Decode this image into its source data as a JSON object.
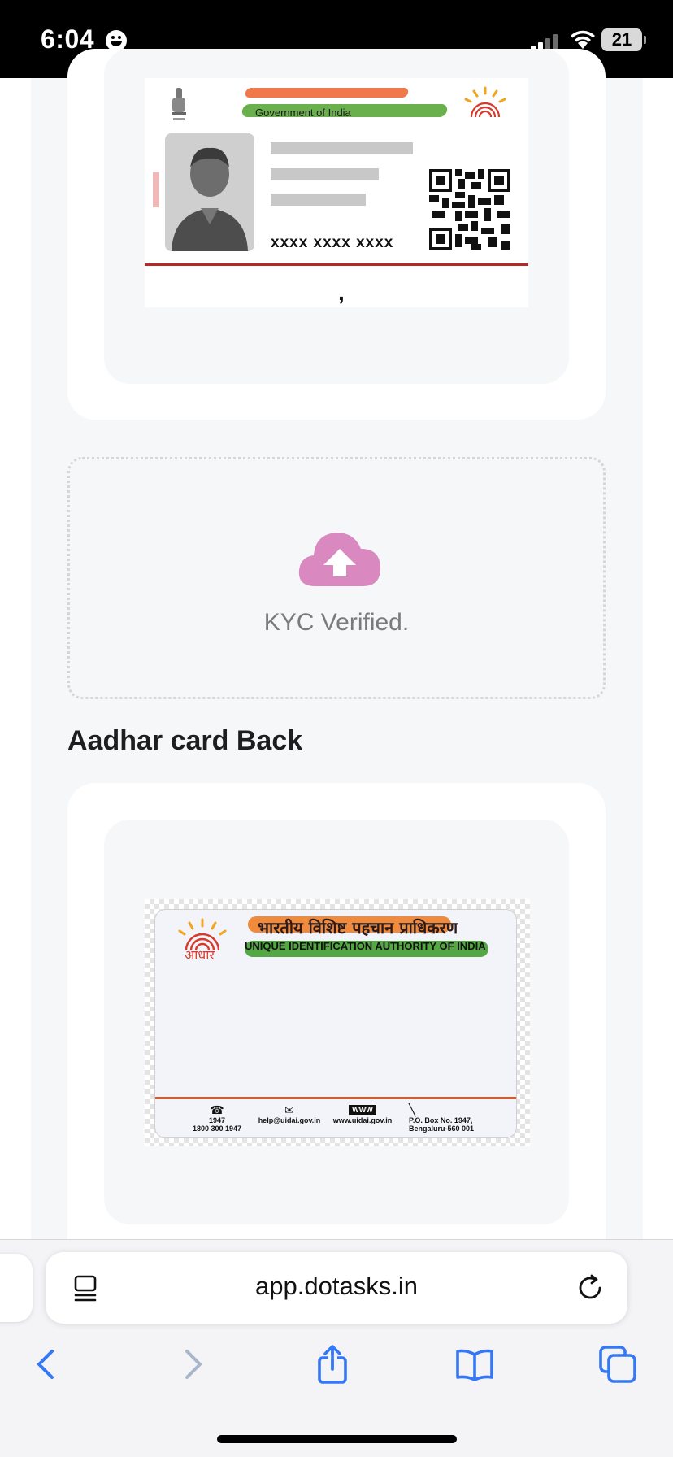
{
  "status_bar": {
    "time": "6:04",
    "battery": "21"
  },
  "front_card": {
    "government_label": "Government of India",
    "masked_number": "xxxx xxxx xxxx",
    "trailing_text": ","
  },
  "upload": {
    "status_text": "KYC Verified.",
    "icon": "cloud-upload-icon",
    "icon_color": "#d989bf"
  },
  "back_section": {
    "title": "Aadhar card Back",
    "hindi_heading": "भारतीय विशिष्ट पहचान प्राधिकरण",
    "english_heading": "UNIQUE IDENTIFICATION AUTHORITY OF INDIA",
    "logo_text": "आधार",
    "footer": {
      "phone_line1": "1947",
      "phone_line2": "1800 300 1947",
      "email": "help@uidai.gov.in",
      "web_badge": "WWW",
      "website": "www.uidai.gov.in",
      "po_line1": "P.O. Box No. 1947,",
      "po_line2": "Bengaluru-560 001"
    }
  },
  "browser": {
    "url": "app.dotasks.in",
    "accent_color": "#3478f6"
  }
}
